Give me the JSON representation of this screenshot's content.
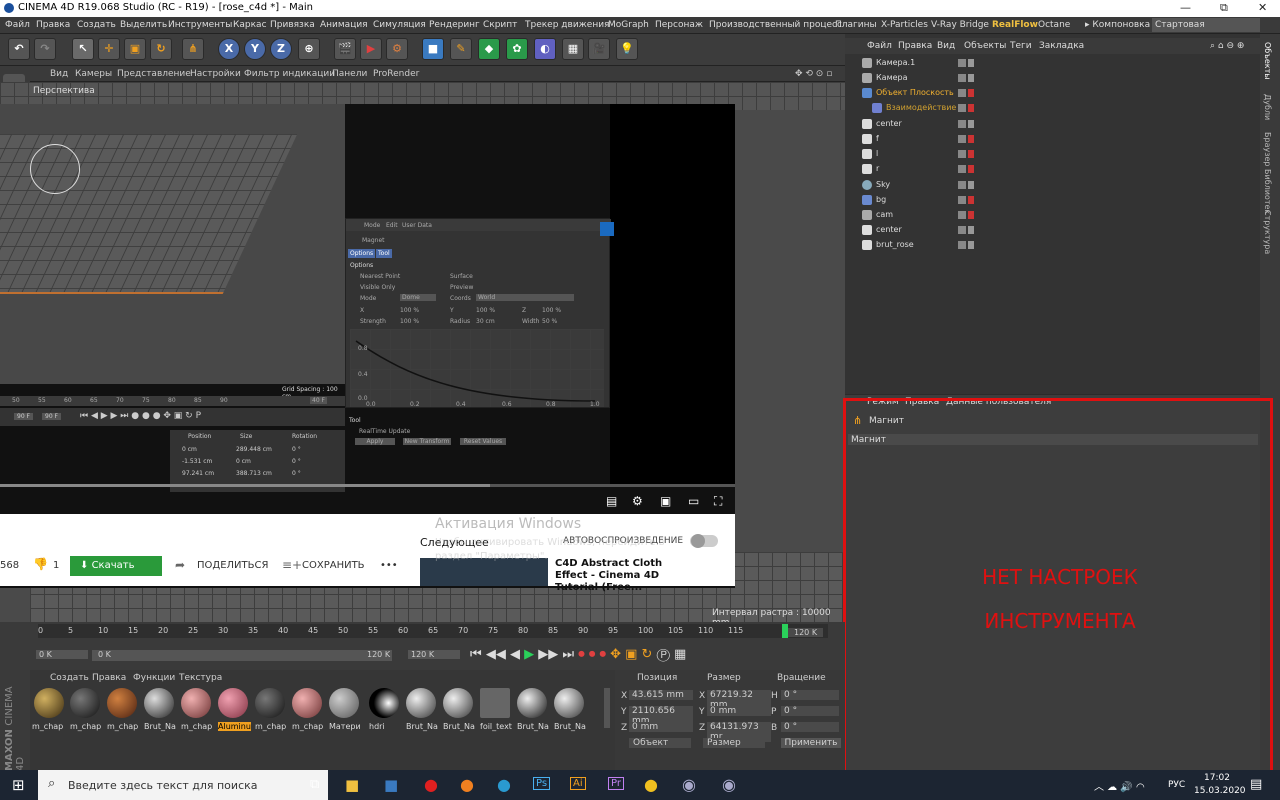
{
  "window": {
    "title": "CINEMA 4D R19.068 Studio (RC - R19) - [rose_c4d *] - Main",
    "min": "—",
    "max": "⧉",
    "close": "✕"
  },
  "menu": [
    "Файл",
    "Правка",
    "Создать",
    "Выделить",
    "Инструменты",
    "Каркас",
    "Привязка",
    "Анимация",
    "Симуляция",
    "Рендеринг",
    "Скрипт",
    "Трекер движения",
    "MoGraph",
    "Персонаж",
    "Производственный процесс",
    "Плагины",
    "X-Particles",
    "V-Ray Bridge",
    "RealFlow",
    "Octane",
    "▸ Компоновка",
    "Стартовая"
  ],
  "toolbar": {
    "x": "X",
    "y": "Y",
    "z": "Z"
  },
  "viewport_menu": [
    "Вид",
    "Камеры",
    "Представление",
    "Настройки",
    "Фильтр индикации",
    "Панели",
    "ProRender"
  ],
  "viewport": {
    "label": "Перспектива",
    "grid_interval": "Интервал растра : 10000 mm"
  },
  "video": {
    "attr_menu": [
      "Mode",
      "Edit",
      "User Data"
    ],
    "attr_title": "Magnet",
    "attr_tabs": [
      "Options",
      "Tool"
    ],
    "options_heading": "Options",
    "fields": [
      "Nearest Point",
      "Visible Only",
      "Mode",
      "Surface",
      "Preview",
      "Coords",
      "X",
      "Y",
      "Z",
      "Strength",
      "Radius",
      "Width"
    ],
    "mode_value": "Dome",
    "coords_value": "World",
    "values": [
      "100 %",
      "100 %",
      "100 %",
      "100 %",
      "30 cm",
      "50 %"
    ],
    "grid_spacing": "Grid Spacing : 100 cm",
    "tool_heading": "Tool",
    "realtime": "RealTime Update",
    "buttons": [
      "Apply",
      "New Transform",
      "Reset Values"
    ],
    "coord_headers": [
      "Position",
      "Size",
      "Rotation"
    ],
    "coord_vals": [
      "0 cm",
      "289.448 cm",
      "0 °",
      "-1.531 cm",
      "0 cm",
      "0 °",
      "97.241 cm",
      "388.713 cm",
      "0 °"
    ],
    "inner_time_fields": [
      "90 F",
      "90 F"
    ],
    "inner_frame": "40 F",
    "inner_ticks": [
      "50",
      "55",
      "60",
      "65",
      "70",
      "75",
      "80",
      "85",
      "90"
    ],
    "graph_x": [
      "0.0",
      "0.2",
      "0.4",
      "0.6",
      "0.8",
      "1.0"
    ],
    "graph_y": [
      "0.8",
      "0.4",
      "0.0"
    ]
  },
  "youtube": {
    "views": "568",
    "likes": "1",
    "download": "Скачать",
    "share": "ПОДЕЛИТЬСЯ",
    "save": "СОХРАНИТЬ",
    "more": "•••",
    "next": "Следующее",
    "autoplay": "АВТОВОСПРОИЗВЕДЕНИЕ",
    "next_title": "C4D Abstract Cloth Effect - Cinema 4D Tutorial (Free...",
    "activation_title": "Активация Windows",
    "activation_sub": "Чтобы активировать Windows, перейдите в раздел \"Параметры\"."
  },
  "objects_menu": [
    "Файл",
    "Правка",
    "Вид",
    "Объекты",
    "Теги",
    "Закладка"
  ],
  "objects": [
    "Камера.1",
    "Камера",
    "Объект Плоскость",
    "Взаимодействие",
    "center",
    "f",
    "l",
    "r",
    "Sky",
    "bg",
    "cam",
    "center",
    "brut_rose"
  ],
  "side_tabs": [
    "Объекты",
    "Дубли",
    "Браузер Библиотек",
    "Структура"
  ],
  "attr_panel": {
    "menu": [
      "Режим",
      "Правка",
      "Данные пользователя"
    ],
    "tool": "Магнит",
    "section": "Магнит"
  },
  "annotation": {
    "line1": "НЕТ НАСТРОЕК",
    "line2": "ИНСТРУМЕНТА",
    "color": "#e01010"
  },
  "timeline": {
    "ticks": [
      "0",
      "5",
      "10",
      "15",
      "20",
      "25",
      "30",
      "35",
      "40",
      "45",
      "50",
      "55",
      "60",
      "65",
      "70",
      "75",
      "80",
      "85",
      "90",
      "95",
      "100",
      "105",
      "110",
      "115"
    ],
    "end": "120 K",
    "start_field": "0 K",
    "cur_field": "0 K",
    "max_field": "120 K",
    "max_field2": "120 K"
  },
  "materials": {
    "menu": [
      "Создать",
      "Правка",
      "Функции",
      "Текстура"
    ],
    "items": [
      "m_chap",
      "m_chap",
      "m_chap",
      "Brut_Na",
      "m_chap",
      "Aluminu",
      "m_chap",
      "m_chap",
      "Матери",
      "hdri",
      "Brut_Na",
      "Brut_Na",
      "foil_text",
      "Brut_Na",
      "Brut_Na"
    ]
  },
  "coordinates": {
    "headers": [
      "Позиция",
      "Размер",
      "Вращение"
    ],
    "rows": [
      {
        "a": "X",
        "v1": "43.615 mm",
        "b": "X",
        "v2": "67219.32 mm",
        "c": "H",
        "v3": "0 °"
      },
      {
        "a": "Y",
        "v1": "2110.656 mm",
        "b": "Y",
        "v2": "0 mm",
        "c": "P",
        "v3": "0 °"
      },
      {
        "a": "Z",
        "v1": "0 mm",
        "b": "Z",
        "v2": "64131.973 mr",
        "c": "B",
        "v3": "0 °"
      }
    ],
    "mode": "Объект",
    "size_mode": "Размер",
    "apply": "Применить"
  },
  "brand": {
    "maxon": "MAXON",
    "cinema": "CINEMA 4D"
  },
  "taskbar": {
    "search": "Введите здесь текст для поиска",
    "lang": "РУС",
    "time": "17:02",
    "date": "15.03.2020"
  }
}
